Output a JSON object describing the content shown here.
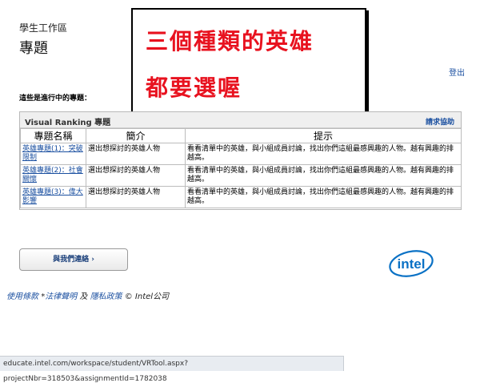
{
  "header": {
    "section_label": "學生工作區",
    "page_title": "專題",
    "logout_label": "登出"
  },
  "annotation": {
    "line1": "三個種類的英雄",
    "line2": "都要選喔"
  },
  "ongoing_label": "這些是進行中的專題：",
  "panel": {
    "title": "Visual Ranking 專題",
    "help_label": "請求協助",
    "columns": [
      "專題名稱",
      "簡介",
      "提示"
    ],
    "rows": [
      {
        "name": "英雄專題(1)：突破限制",
        "intro": "選出想探討的英雄人物",
        "hint": "看看清單中的英雄，與小組成員討論，找出你們這組最感興趣的人物。越有興趣的排越高。"
      },
      {
        "name": "英雄專題(2)：社會關懷",
        "intro": "選出想探討的英雄人物",
        "hint": "看看清單中的英雄，與小組成員討論，找出你們這組最感興趣的人物。越有興趣的排越高。"
      },
      {
        "name": "英雄專題(3)：偉大影響",
        "intro": "選出想探討的英雄人物",
        "hint": "看看清單中的英雄，與小組成員討論，找出你們這組最感興趣的人物。越有興趣的排越高。"
      }
    ]
  },
  "contact_button_label": "與我們連絡 ›",
  "logo_text": "intel",
  "footer": {
    "terms": "使用條款",
    "legal_prefix": "*",
    "legal": "法律聲明",
    "and": "及",
    "privacy": "隱私政策",
    "copyright": "© Intel公司"
  },
  "status_url": "educate.intel.com/workspace/student/VRTool.aspx?projectNbr=318503&assignmentId=1782038",
  "colors": {
    "annotation_text": "#e8121f",
    "link": "#1a4fa0",
    "intel_blue": "#0a71c5"
  }
}
